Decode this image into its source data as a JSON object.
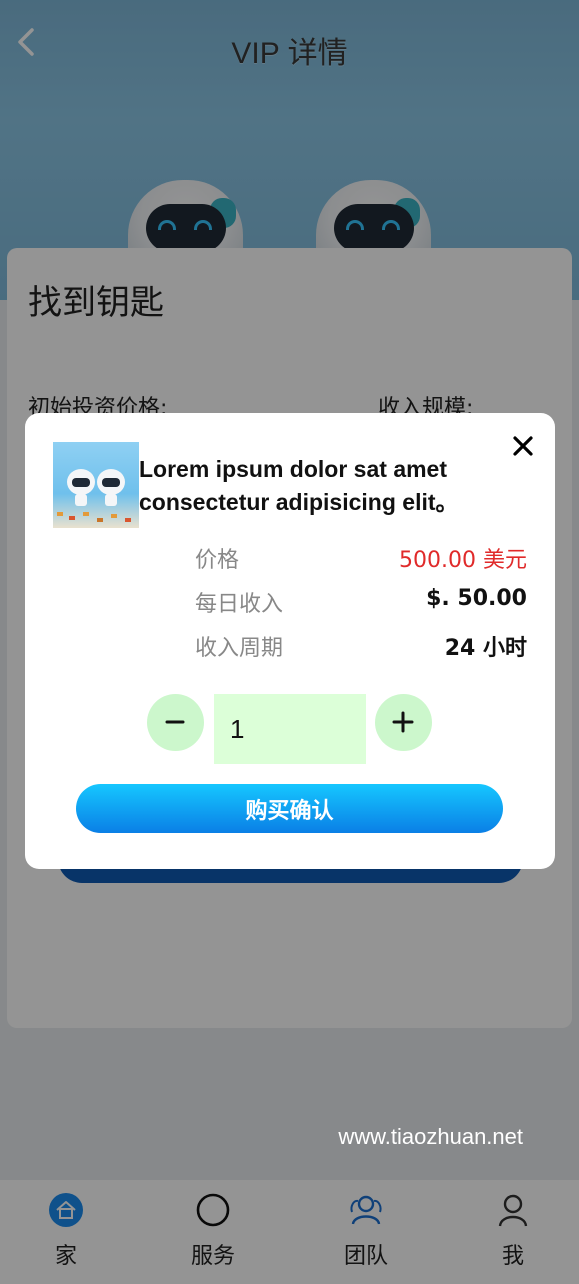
{
  "header": {
    "title": "VIP 详情",
    "back_icon": "chevron-left-icon"
  },
  "card": {
    "title": "找到钥匙",
    "initial_price_label": "初始投资价格:",
    "income_scale_label": "收入规模:"
  },
  "modal": {
    "product_title": "Lorem ipsum dolor sat amet consectetur adipisicing elit。",
    "rows": [
      {
        "label": "价格",
        "value": "500.00 美元"
      },
      {
        "label": "每日收入",
        "value": "$. 50.00"
      },
      {
        "label": "收入周期",
        "value": "24 小时"
      }
    ],
    "quantity": "1",
    "minus_label": "−",
    "plus_label": "+",
    "confirm_label": "购买确认",
    "price_color": "#e02a2a"
  },
  "watermark": "www.tiaozhuan.net",
  "nav": {
    "items": [
      {
        "label": "家",
        "icon": "home-icon"
      },
      {
        "label": "服务",
        "icon": "circle-icon"
      },
      {
        "label": "团队",
        "icon": "team-icon"
      },
      {
        "label": "我",
        "icon": "user-icon"
      }
    ]
  },
  "colors": {
    "accent": "#0a7fe6",
    "stepper": "#ccf7cc"
  }
}
